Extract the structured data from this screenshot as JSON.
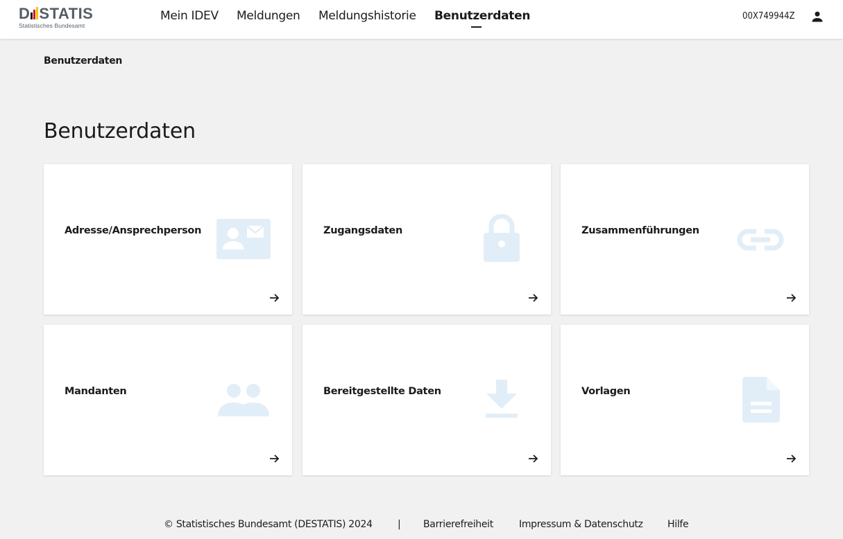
{
  "header": {
    "logo": {
      "word_left": "D",
      "word_right": "STATIS",
      "subtitle": "Statistisches Bundesamt",
      "bar_colors": [
        "#1b1b1b",
        "#d8121c",
        "#f5c400"
      ]
    },
    "nav": [
      {
        "label": "Mein IDEV",
        "active": false
      },
      {
        "label": "Meldungen",
        "active": false
      },
      {
        "label": "Meldungshistorie",
        "active": false
      },
      {
        "label": "Benutzerdaten",
        "active": true
      }
    ],
    "user_id": "00X749944Z",
    "user_icon": "person-icon"
  },
  "breadcrumb": "Benutzerdaten",
  "page_title": "Benutzerdaten",
  "cards": [
    {
      "title": "Adresse/Ansprechperson",
      "icon": "contact-card-icon"
    },
    {
      "title": "Zugangsdaten",
      "icon": "lock-icon"
    },
    {
      "title": "Zusammenführungen",
      "icon": "link-icon"
    },
    {
      "title": "Mandanten",
      "icon": "people-icon"
    },
    {
      "title": "Bereitgestellte Daten",
      "icon": "download-icon"
    },
    {
      "title": "Vorlagen",
      "icon": "document-icon"
    }
  ],
  "footer": {
    "copyright": "© Statistisches Bundesamt (DESTATIS) 2024",
    "separator": "|",
    "links": [
      "Barrierefreiheit",
      "Impressum & Datenschutz",
      "Hilfe"
    ]
  },
  "colors": {
    "background": "#f1f1f1",
    "card": "#ffffff",
    "icon_tint": "#e2eef7",
    "text": "#1b1b1b"
  }
}
